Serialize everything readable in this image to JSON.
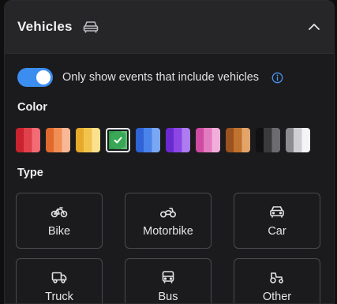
{
  "header": {
    "title": "Vehicles",
    "icon": "car-outline-icon",
    "collapse_icon": "chevron-up-icon"
  },
  "filter": {
    "toggle_on": true,
    "label": "Only show events that include vehicles",
    "info_icon": "info-icon",
    "accent": "#3b8df0"
  },
  "color_section": {
    "label": "Color",
    "swatches": [
      {
        "name": "red",
        "colors": [
          "#c9232f",
          "#e0414b",
          "#f36b74"
        ],
        "selected": false
      },
      {
        "name": "orange",
        "colors": [
          "#e06a2d",
          "#f08e56",
          "#f8b896"
        ],
        "selected": false
      },
      {
        "name": "yellow",
        "colors": [
          "#e6a92a",
          "#f3c44d",
          "#fbe08e"
        ],
        "selected": false
      },
      {
        "name": "green",
        "colors": [
          "#2d9a49",
          "#3aa756",
          "#5cc175"
        ],
        "selected": true
      },
      {
        "name": "blue",
        "colors": [
          "#2f63d6",
          "#4a83ea",
          "#7aa7f3"
        ],
        "selected": false
      },
      {
        "name": "purple",
        "colors": [
          "#6a2ad0",
          "#8b47e4",
          "#ad7cf1"
        ],
        "selected": false
      },
      {
        "name": "pink",
        "colors": [
          "#cf4aa1",
          "#e27bc0",
          "#f2aedb"
        ],
        "selected": false
      },
      {
        "name": "brown",
        "colors": [
          "#9b5220",
          "#c0722f",
          "#e3a46a"
        ],
        "selected": false
      },
      {
        "name": "black",
        "colors": [
          "#111113",
          "#3a3a3d",
          "#6b6b70"
        ],
        "selected": false
      },
      {
        "name": "white",
        "colors": [
          "#8c8c90",
          "#cfcfd3",
          "#f4f4f6"
        ],
        "selected": false
      }
    ]
  },
  "type_section": {
    "label": "Type",
    "items": [
      {
        "label": "Bike",
        "icon": "bicycle-icon"
      },
      {
        "label": "Motorbike",
        "icon": "motorbike-icon"
      },
      {
        "label": "Car",
        "icon": "car-icon"
      },
      {
        "label": "Truck",
        "icon": "truck-icon"
      },
      {
        "label": "Bus",
        "icon": "bus-icon"
      },
      {
        "label": "Other",
        "icon": "tractor-icon"
      }
    ]
  }
}
